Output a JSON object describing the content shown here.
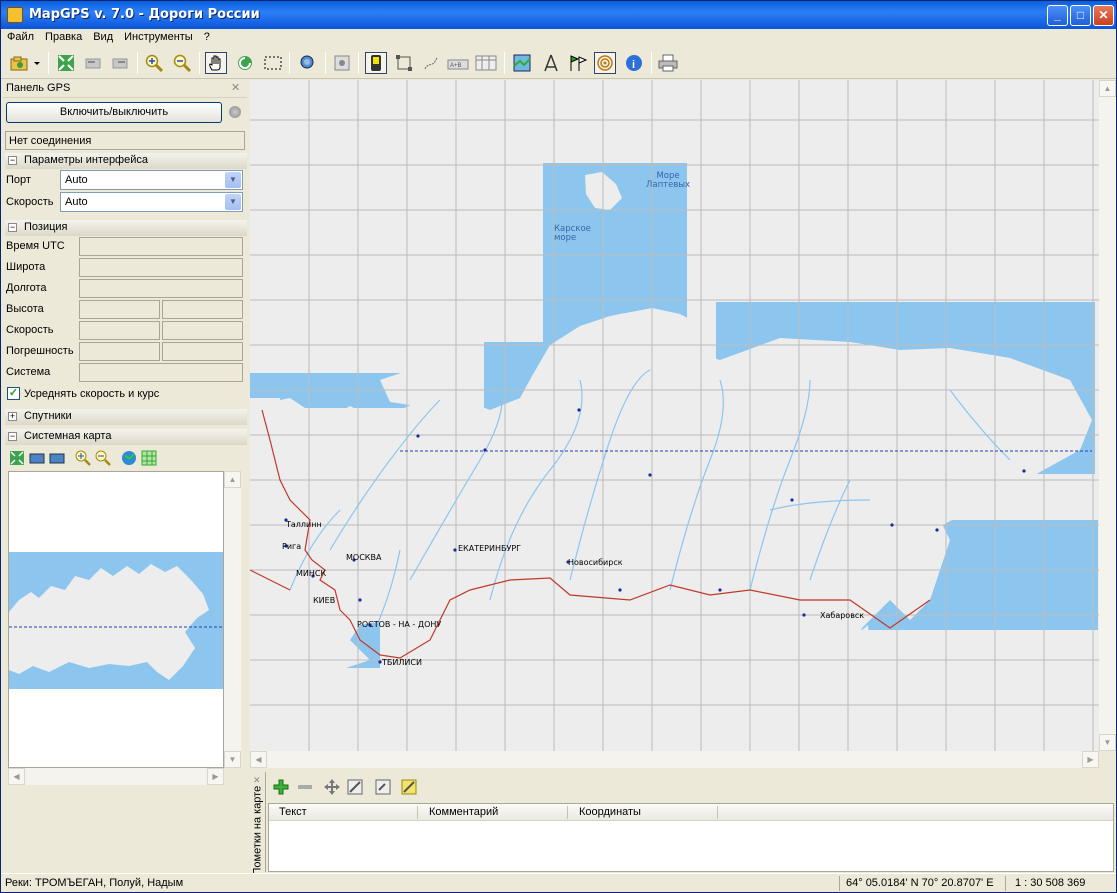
{
  "window": {
    "title": "MapGPS v. 7.0 - Дороги России"
  },
  "menu": [
    "Файл",
    "Правка",
    "Вид",
    "Инструменты",
    "?"
  ],
  "toolbar": {
    "icons": [
      "open-icon",
      "fit-map-icon",
      "back-icon",
      "forward-icon",
      "zoom-in-icon",
      "zoom-out-icon",
      "hand-pan-icon",
      "rotate-icon",
      "select-rect-icon",
      "find-icon",
      "center-gps-icon",
      "gps-device-icon",
      "select-area-icon",
      "route-icon",
      "measure-icon",
      "table-icon",
      "layers-icon",
      "compass-tool-icon",
      "flags-icon",
      "gps-signal-icon",
      "info-icon",
      "print-icon"
    ]
  },
  "gps_panel": {
    "title": "Панель GPS",
    "toggle_button": "Включить/выключить",
    "connection_status": "Нет соединения",
    "interface_section": "Параметры интерфейса",
    "port_label": "Порт",
    "port_value": "Auto",
    "speed_label": "Скорость",
    "speed_value": "Auto",
    "position_section": "Позиция",
    "fields": [
      "Время UTC",
      "Широта",
      "Долгота",
      "Высота",
      "Скорость",
      "Погрешность",
      "Система"
    ],
    "average_checkbox": "Усреднять скорость и курс",
    "average_checked": true,
    "satellites_section": "Спутники",
    "system_map_section": "Системная карта"
  },
  "map": {
    "seas": [
      "Море\nЛаптевых",
      "Карское\nморе"
    ],
    "cities": [
      "Таллинн",
      "Рига",
      "МИНСК",
      "МОСКВА",
      "КИЕВ",
      "РОСТОВ - НА - ДОНУ",
      "ТБИЛИСИ",
      "ЕКАТЕРИНБУРГ",
      "Новосибирск",
      "Хабаровск"
    ],
    "colors": {
      "water": "#8cc6ee",
      "land": "#ededed",
      "border": "#c0392b",
      "river": "#8cc6ee"
    }
  },
  "notes_panel": {
    "tab_label": "Пометки на карте",
    "columns": [
      "Текст",
      "Комментарий",
      "Координаты"
    ]
  },
  "status": {
    "rivers": "Реки: ТРОМЪЕГАН, Полуй, Надым",
    "coordinates": "64° 05.0184' N  70° 20.8707' E",
    "scale": "1 : 30 508 369"
  }
}
